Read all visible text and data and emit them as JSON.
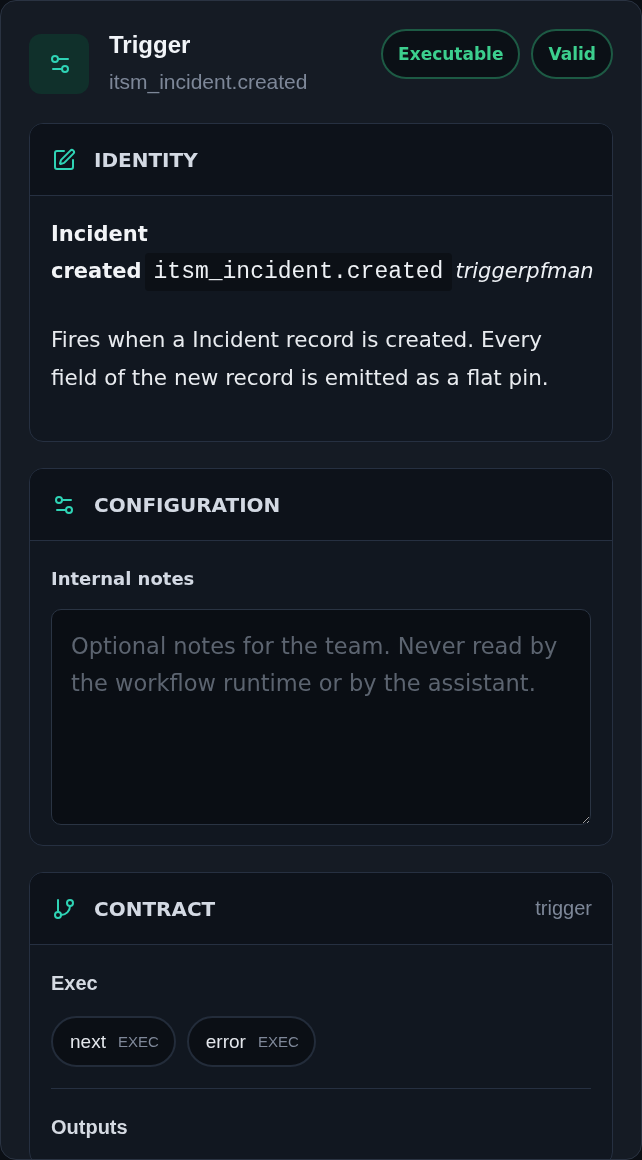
{
  "header": {
    "title": "Trigger",
    "subtitle": "itsm_incident.created",
    "badges": [
      "Executable",
      "Valid"
    ]
  },
  "sections": [
    {
      "kind": "identity",
      "title": "IDENTITY",
      "heading_lines": [
        "Incident",
        "created"
      ],
      "code": "itsm_incident.created",
      "italic_text": "triggerpfman",
      "description": "Fires when a Incident record is created. Every field of the new record is emitted as a flat pin."
    },
    {
      "kind": "configuration",
      "title": "CONFIGURATION",
      "field": {
        "label": "Internal notes",
        "placeholder": "Optional notes for the team. Never read by the workflow runtime or by the assistant."
      }
    },
    {
      "kind": "contract",
      "title": "CONTRACT",
      "aside": "trigger",
      "groups": [
        {
          "label": "Exec",
          "pins": [
            {
              "name": "next",
              "type": "EXEC"
            },
            {
              "name": "error",
              "type": "EXEC"
            }
          ]
        },
        {
          "label": "Outputs"
        }
      ]
    }
  ]
}
